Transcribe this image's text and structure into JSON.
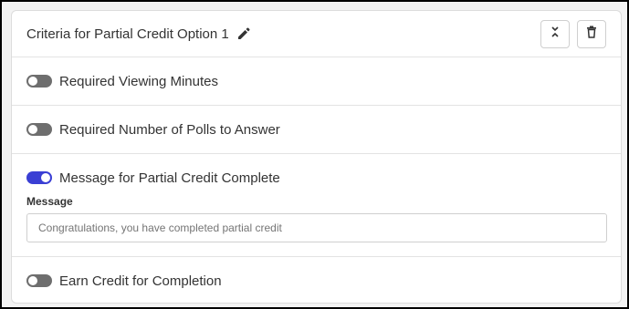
{
  "header": {
    "title": "Criteria for Partial Credit Option 1",
    "edit_icon": "pencil-icon",
    "collapse_icon": "collapse-chevrons-icon",
    "delete_icon": "trash-icon"
  },
  "criteria": {
    "viewing_minutes": {
      "label": "Required Viewing Minutes",
      "enabled": false
    },
    "polls": {
      "label": "Required Number of Polls to Answer",
      "enabled": false
    },
    "message": {
      "label": "Message for Partial Credit Complete",
      "enabled": true,
      "field_label": "Message",
      "value": "Congratulations, you have completed partial credit"
    },
    "completion": {
      "label": "Earn Credit for Completion",
      "enabled": false
    }
  },
  "colors": {
    "toggle_on": "#3a3fd4",
    "toggle_off": "#6e6e6e"
  }
}
